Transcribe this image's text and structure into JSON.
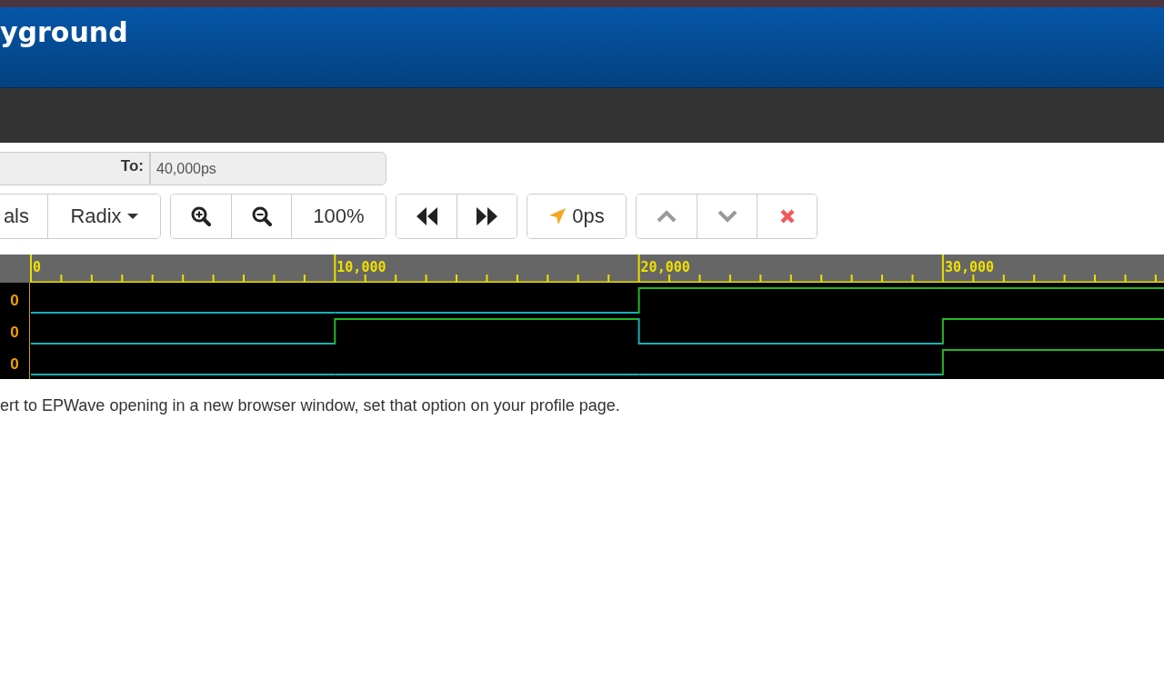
{
  "header": {
    "title": "yground"
  },
  "range": {
    "to_label": "To:",
    "to_value": "40,000ps"
  },
  "toolbar": {
    "groups": [
      [
        {
          "kind": "text",
          "label": "als"
        },
        {
          "kind": "dropdown",
          "label": "Radix"
        }
      ],
      [
        {
          "kind": "zoomin"
        },
        {
          "kind": "zoomout"
        },
        {
          "kind": "text",
          "label": "100%"
        }
      ],
      [
        {
          "kind": "rewind"
        },
        {
          "kind": "forward"
        }
      ],
      [
        {
          "kind": "cursor",
          "label": "0ps"
        }
      ],
      [
        {
          "kind": "up"
        },
        {
          "kind": "down"
        },
        {
          "kind": "remove"
        }
      ]
    ]
  },
  "waveform": {
    "ruler_labels": [
      "0",
      "10,000",
      "20,000",
      "30,000"
    ],
    "signals": [
      {
        "value": "0",
        "high": [
          false,
          false,
          true,
          true
        ]
      },
      {
        "value": "0",
        "high": [
          false,
          true,
          false,
          true
        ]
      },
      {
        "value": "0",
        "high": [
          false,
          false,
          false,
          true
        ]
      }
    ]
  },
  "note": "ert to EPWave opening in a new browser window, set that option on your profile page."
}
